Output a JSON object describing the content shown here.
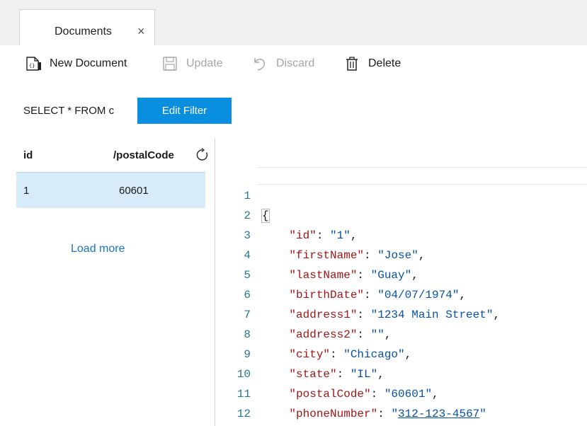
{
  "tab": {
    "label": "Documents",
    "close": "×"
  },
  "toolbar": {
    "new_document": "New Document",
    "update": "Update",
    "discard": "Discard",
    "delete": "Delete"
  },
  "query": {
    "text": "SELECT * FROM c",
    "edit_filter": "Edit Filter"
  },
  "grid": {
    "columns": [
      "id",
      "/postalCode"
    ],
    "rows": [
      {
        "id": "1",
        "postalCode": "60601"
      }
    ],
    "load_more": "Load more"
  },
  "editor": {
    "lines": [
      {
        "n": "1",
        "open": "{"
      },
      {
        "n": "2",
        "key": "\"id\"",
        "value": "\"1\"",
        "comma": ","
      },
      {
        "n": "3",
        "key": "\"firstName\"",
        "value": "\"Jose\"",
        "comma": ","
      },
      {
        "n": "4",
        "key": "\"lastName\"",
        "value": "\"Guay\"",
        "comma": ","
      },
      {
        "n": "5",
        "key": "\"birthDate\"",
        "value": "\"04/07/1974\"",
        "comma": ","
      },
      {
        "n": "6",
        "key": "\"address1\"",
        "value": "\"1234 Main Street\"",
        "comma": ","
      },
      {
        "n": "7",
        "key": "\"address2\"",
        "value": "\"\"",
        "comma": ","
      },
      {
        "n": "8",
        "key": "\"city\"",
        "value": "\"Chicago\"",
        "comma": ","
      },
      {
        "n": "9",
        "key": "\"state\"",
        "value": "\"IL\"",
        "comma": ","
      },
      {
        "n": "10",
        "key": "\"postalCode\"",
        "value": "\"60601\"",
        "comma": ","
      },
      {
        "n": "11",
        "key": "\"phoneNumber\"",
        "value_q1": "\"",
        "value_link": "312-123-4567",
        "value_q2": "\""
      },
      {
        "n": "12",
        "close": "}"
      }
    ]
  },
  "colors": {
    "accent": "#0a8fe0",
    "selection": "#d8ebf9",
    "json_key": "#a31515",
    "json_string": "#0451a5",
    "line_number": "#237893"
  }
}
